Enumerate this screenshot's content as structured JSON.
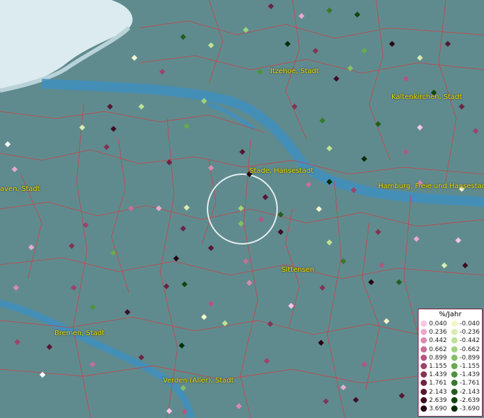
{
  "map": {
    "cities": [
      {
        "name": "Itzehoe, Stadt"
      },
      {
        "name": "Kaltenkirchen, Stadt"
      },
      {
        "name": "Stade, Hansestadt"
      },
      {
        "name": "Hamburg, Freie und Hansestadt"
      },
      {
        "name": "aven, Stadt"
      },
      {
        "name": "Sittensen"
      },
      {
        "name": "Bremen, Stadt"
      },
      {
        "name": "Verden (Aller), Stadt"
      }
    ]
  },
  "legend": {
    "title": "%/Jahr",
    "positive": [
      {
        "label": "0.040",
        "color": "#f5c6e6"
      },
      {
        "label": "0.236",
        "color": "#e9a8cc"
      },
      {
        "label": "0.442",
        "color": "#d98ab1"
      },
      {
        "label": "0.662",
        "color": "#c66f97"
      },
      {
        "label": "0.899",
        "color": "#b2577f"
      },
      {
        "label": "1.155",
        "color": "#9a4469"
      },
      {
        "label": "1.439",
        "color": "#823455"
      },
      {
        "label": "1.761",
        "color": "#6b2543"
      },
      {
        "label": "2.143",
        "color": "#551833"
      },
      {
        "label": "2.639",
        "color": "#3e0d24"
      },
      {
        "label": "3.690",
        "color": "#260514"
      }
    ],
    "negative": [
      {
        "label": "-0.040",
        "color": "#f4f6c8"
      },
      {
        "label": "-0.236",
        "color": "#d8ecb0"
      },
      {
        "label": "-0.442",
        "color": "#bde297"
      },
      {
        "label": "-0.662",
        "color": "#a0d27e"
      },
      {
        "label": "-0.899",
        "color": "#84c066"
      },
      {
        "label": "-1.155",
        "color": "#67aa50"
      },
      {
        "label": "-1.439",
        "color": "#4d923c"
      },
      {
        "label": "-1.761",
        "color": "#36792b"
      },
      {
        "label": "-2.143",
        "color": "#225f1d"
      },
      {
        "label": "-2.639",
        "color": "#134510"
      },
      {
        "label": "-3.690",
        "color": "#062c05"
      }
    ]
  }
}
